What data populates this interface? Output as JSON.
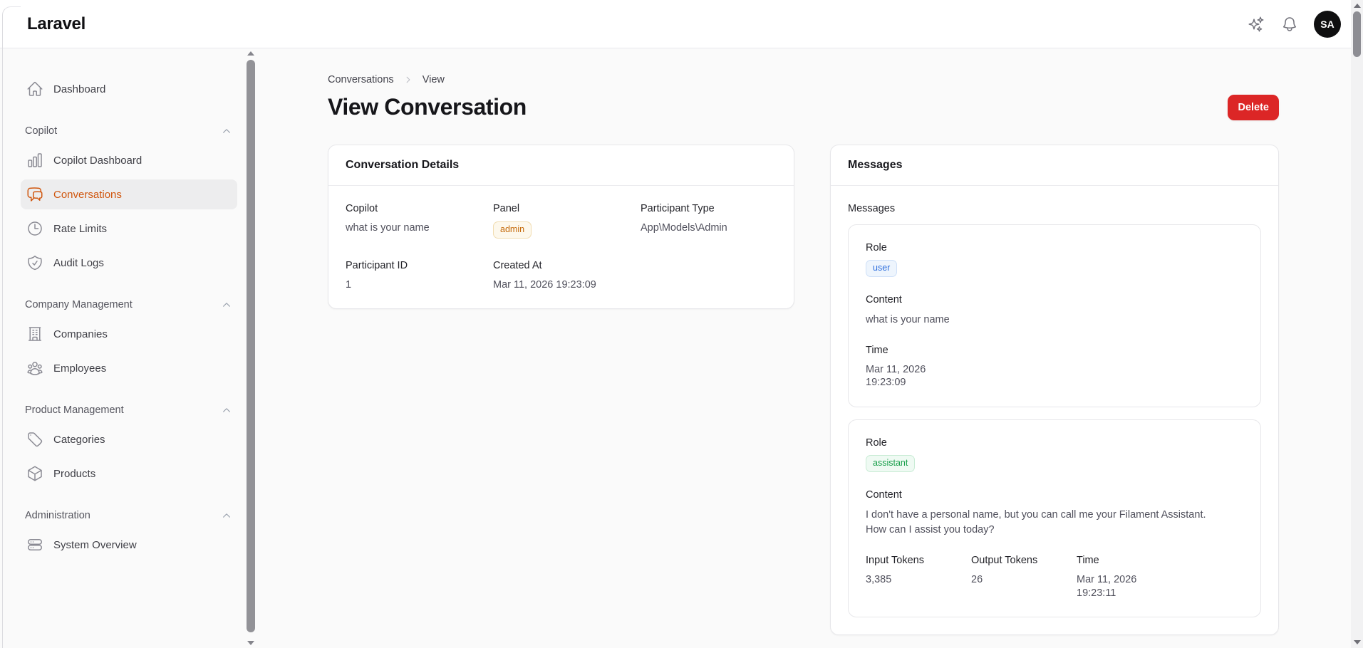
{
  "topbar": {
    "brand": "Laravel",
    "avatar_initials": "SA"
  },
  "sidebar": {
    "groups": [
      {
        "items": [
          {
            "label": "Dashboard",
            "icon": "home-icon"
          }
        ]
      },
      {
        "label": "Copilot",
        "items": [
          {
            "label": "Copilot Dashboard",
            "icon": "chart-bar-icon"
          },
          {
            "label": "Conversations",
            "icon": "chat-bubbles-icon",
            "active": true
          },
          {
            "label": "Rate Limits",
            "icon": "clock-icon"
          },
          {
            "label": "Audit Logs",
            "icon": "shield-check-icon"
          }
        ]
      },
      {
        "label": "Company Management",
        "items": [
          {
            "label": "Companies",
            "icon": "building-office-icon"
          },
          {
            "label": "Employees",
            "icon": "user-group-icon"
          }
        ]
      },
      {
        "label": "Product Management",
        "items": [
          {
            "label": "Categories",
            "icon": "tag-icon"
          },
          {
            "label": "Products",
            "icon": "cube-icon"
          }
        ]
      },
      {
        "label": "Administration",
        "items": [
          {
            "label": "System Overview",
            "icon": "server-stack-icon"
          }
        ]
      }
    ]
  },
  "page": {
    "breadcrumb": {
      "parent": "Conversations",
      "current": "View"
    },
    "title": "View Conversation",
    "delete_label": "Delete"
  },
  "details_card": {
    "title": "Conversation Details",
    "fields": {
      "copilot": {
        "label": "Copilot",
        "value": "what is your name"
      },
      "panel": {
        "label": "Panel",
        "value": "admin",
        "badge_color": "#c56a0b"
      },
      "ptype": {
        "label": "Participant Type",
        "value": "App\\Models\\Admin"
      },
      "pid": {
        "label": "Participant ID",
        "value": "1"
      },
      "created": {
        "label": "Created At",
        "value": "Mar 11, 2026 19:23:09"
      }
    }
  },
  "messages_card": {
    "title": "Messages",
    "list_label": "Messages",
    "field_labels": {
      "role": "Role",
      "content": "Content",
      "time": "Time",
      "input_tokens": "Input Tokens",
      "output_tokens": "Output Tokens"
    },
    "messages": [
      {
        "role": "user",
        "role_color": "#2f6fdd",
        "content": "what is your name",
        "time": "Mar 11, 2026 19:23:09"
      },
      {
        "role": "assistant",
        "role_color": "#199f4b",
        "content": "I don't have a personal name, but you can call me your Filament Assistant. How can I assist you today?",
        "input_tokens": "3,385",
        "output_tokens": "26",
        "time": "Mar 11, 2026 19:23:11"
      }
    ]
  },
  "colors": {
    "accent": "#d0560e",
    "danger": "#dc2626",
    "page_background": "#fafafa",
    "card_background": "#ffffff"
  }
}
